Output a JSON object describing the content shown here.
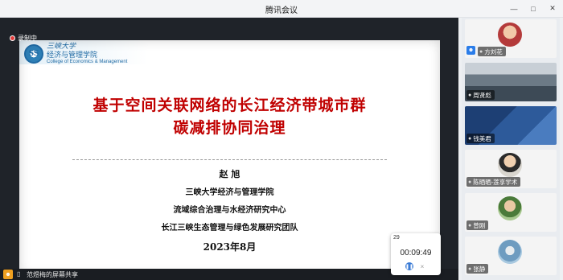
{
  "window": {
    "title": "腾讯会议"
  },
  "recording": {
    "label": "录制中"
  },
  "slide": {
    "logo_cn_top": "三峡大学",
    "logo_cn": "经济与管理学院",
    "logo_en": "College of Economics & Management",
    "logo_seal": "SS",
    "title_line1": "基于空间关联网络的长江经济带城市群",
    "title_line2": "碳减排协同治理",
    "author": "赵 旭",
    "affiliation1": "三峡大学经济与管理学院",
    "affiliation2": "流域综合治理与水经济研究中心",
    "affiliation3": "长江三峡生态管理与绿色发展研究团队",
    "date": "2023年8月"
  },
  "timer": {
    "index": "29",
    "time": "00:09:49",
    "pause_icon": "pause-icon",
    "close_icon": "close-icon"
  },
  "sharebar": {
    "label": "范煜梅的屏幕共享"
  },
  "participants": [
    {
      "name": "方刘花",
      "bg": "#b43a3a"
    },
    {
      "name": "周贤彪",
      "bg": "#6c7a86"
    },
    {
      "name": "钱美君",
      "bg": "#2d5a9a"
    },
    {
      "name": "陈晒晒-莲享学术",
      "bg": "#e8e6e0"
    },
    {
      "name": "曾刚",
      "bg": "#7fa46a"
    },
    {
      "name": "张静",
      "bg": "#6e9cc0"
    }
  ]
}
